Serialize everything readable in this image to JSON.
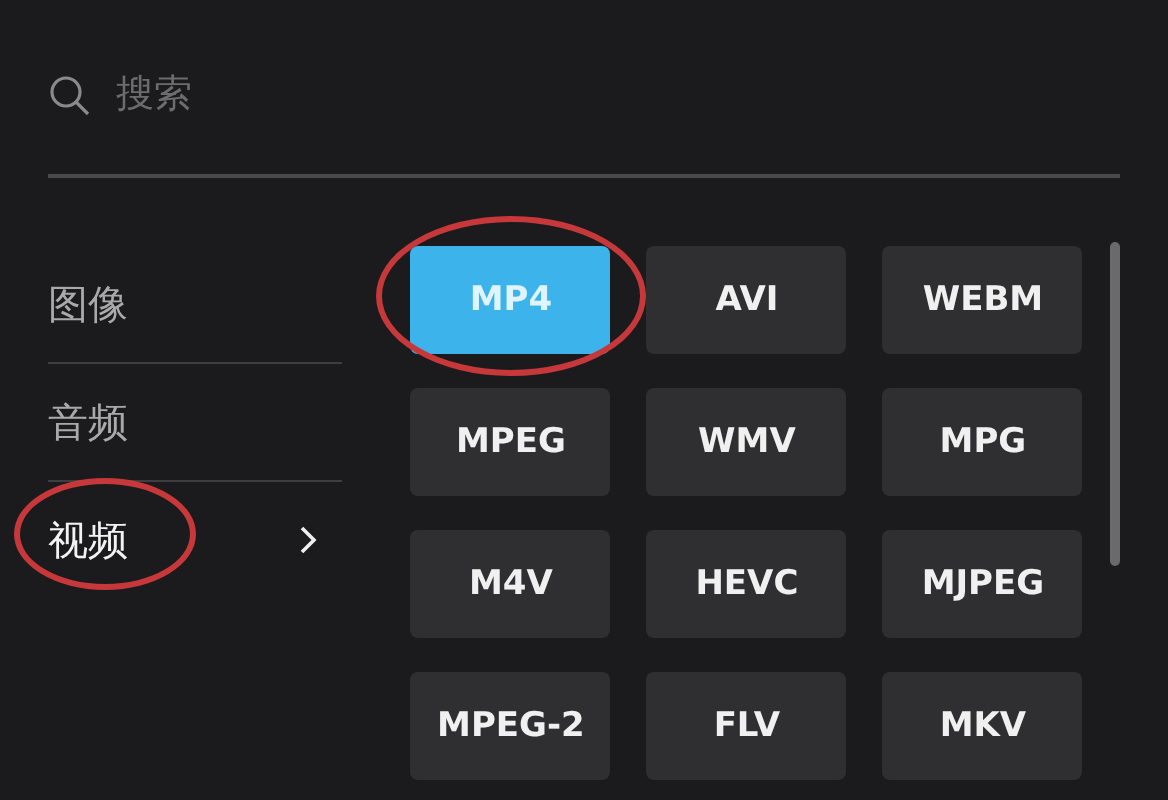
{
  "search": {
    "placeholder": "搜索"
  },
  "categories": [
    {
      "label": "图像",
      "selected": false,
      "annotated": false
    },
    {
      "label": "音频",
      "selected": false,
      "annotated": false
    },
    {
      "label": "视频",
      "selected": true,
      "annotated": true
    }
  ],
  "formats": [
    {
      "label": "MP4",
      "selected": true,
      "annotated": true
    },
    {
      "label": "AVI",
      "selected": false,
      "annotated": false
    },
    {
      "label": "WEBM",
      "selected": false,
      "annotated": false
    },
    {
      "label": "MPEG",
      "selected": false,
      "annotated": false
    },
    {
      "label": "WMV",
      "selected": false,
      "annotated": false
    },
    {
      "label": "MPG",
      "selected": false,
      "annotated": false
    },
    {
      "label": "M4V",
      "selected": false,
      "annotated": false
    },
    {
      "label": "HEVC",
      "selected": false,
      "annotated": false
    },
    {
      "label": "MJPEG",
      "selected": false,
      "annotated": false
    },
    {
      "label": "MPEG-2",
      "selected": false,
      "annotated": false
    },
    {
      "label": "FLV",
      "selected": false,
      "annotated": false
    },
    {
      "label": "MKV",
      "selected": false,
      "annotated": false
    }
  ]
}
